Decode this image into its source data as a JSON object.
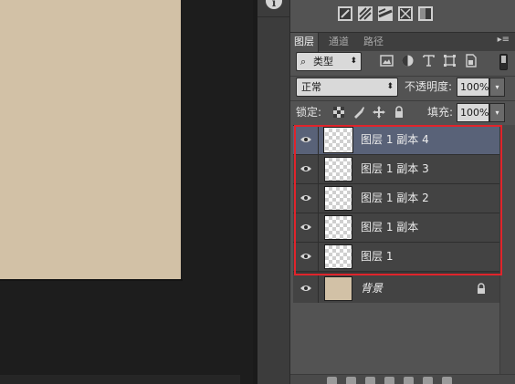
{
  "colors": {
    "canvas": "#d2c1a6",
    "selection_outline": "#e0242b",
    "selected_layer": "#596278",
    "panel": "#535353"
  },
  "panel": {
    "tabs": [
      {
        "label": "图层",
        "active": true
      },
      {
        "label": "通道",
        "active": false
      },
      {
        "label": "路径",
        "active": false
      }
    ],
    "menu_icon": "panel-menu-icon",
    "filter": {
      "value": "类型",
      "icon": "search-icon"
    },
    "blend_mode": {
      "value": "正常"
    },
    "opacity": {
      "label": "不透明度:",
      "value": "100%"
    },
    "lock": {
      "label": "锁定:"
    },
    "fill": {
      "label": "填充:",
      "value": "100%"
    }
  },
  "layers": [
    {
      "name": "图层 1 副本 4",
      "selected": true,
      "visible": true
    },
    {
      "name": "图层 1 副本 3",
      "selected": false,
      "visible": true
    },
    {
      "name": "图层 1 副本 2",
      "selected": false,
      "visible": true
    },
    {
      "name": "图层 1 副本",
      "selected": false,
      "visible": true
    },
    {
      "name": "图层 1",
      "selected": false,
      "visible": true
    },
    {
      "name": "背景",
      "selected": false,
      "visible": true,
      "locked": true,
      "fill": "#d2c1a6"
    }
  ]
}
